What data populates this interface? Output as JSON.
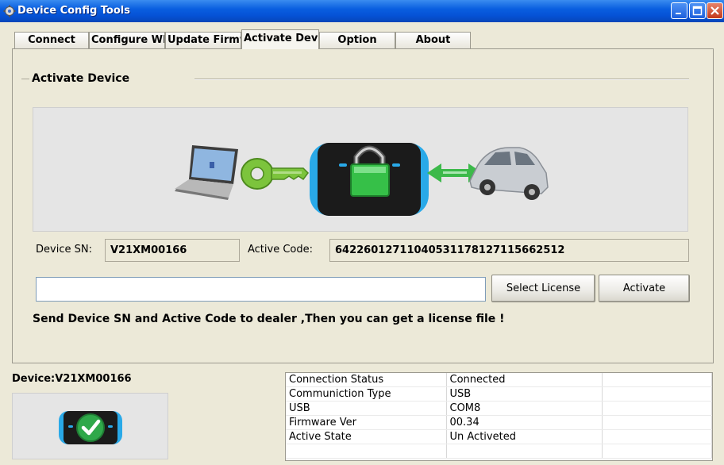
{
  "window": {
    "title": "Device Config Tools",
    "minimize_label": "_",
    "maximize_label": "□",
    "close_label": "✕"
  },
  "tabs": [
    {
      "label": "Connect"
    },
    {
      "label": "Configure WIFI"
    },
    {
      "label": "Update Firmware"
    },
    {
      "label": "Activate Device",
      "active": true
    },
    {
      "label": "Option"
    },
    {
      "label": "About"
    }
  ],
  "activate": {
    "group_title": "Activate Device",
    "sn_label": "Device SN:",
    "sn_value": "V21XM00166",
    "code_label": "Active Code:",
    "code_value": "64226012711040531178127115662512",
    "license_path": "",
    "select_license_label": "Select License",
    "activate_label": "Activate",
    "hint": "Send Device SN and Active Code to dealer ,Then you can get a license file !"
  },
  "device": {
    "label": "Device:V21XM00166"
  },
  "status": {
    "rows": [
      {
        "name": "Connection Status",
        "value": "Connected"
      },
      {
        "name": "Communiction Type",
        "value": "USB"
      },
      {
        "name": "USB",
        "value": "COM8"
      },
      {
        "name": "Firmware Ver",
        "value": "00.34"
      },
      {
        "name": "Active State",
        "value": "Un Activeted"
      }
    ]
  },
  "icons": {
    "app": "gear-icon",
    "illustration": [
      "laptop-icon",
      "key-icon",
      "locked-device-icon",
      "arrow-icon",
      "car-icon"
    ],
    "device_status": "device-check-icon"
  },
  "colors": {
    "titlebar": "#0552d6",
    "device_accent": "#29a9e8",
    "key_green": "#7cc43c",
    "arrow_green": "#3cb94a",
    "check_green": "#2fa84a"
  }
}
